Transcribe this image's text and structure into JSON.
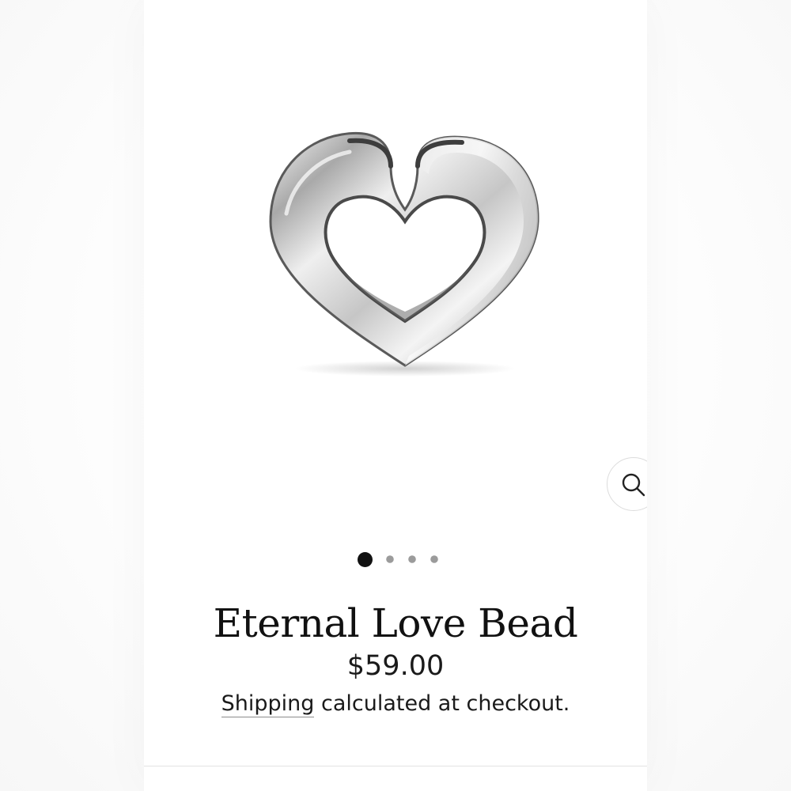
{
  "product": {
    "title": "Eternal Love Bead",
    "price": "$59.00",
    "shipping_link_text": "Shipping",
    "shipping_rest_text": " calculated at checkout."
  },
  "gallery": {
    "image_icon": "silver-open-heart-bead",
    "zoom_icon": "magnifier-icon",
    "slide_count": 4,
    "active_slide": 1
  },
  "colors": {
    "page_background": "#ffffff",
    "text": "#111111",
    "dot_active": "#111111",
    "dot_inactive": "#9b9b9b",
    "zoom_border": "#dcdcdc"
  }
}
